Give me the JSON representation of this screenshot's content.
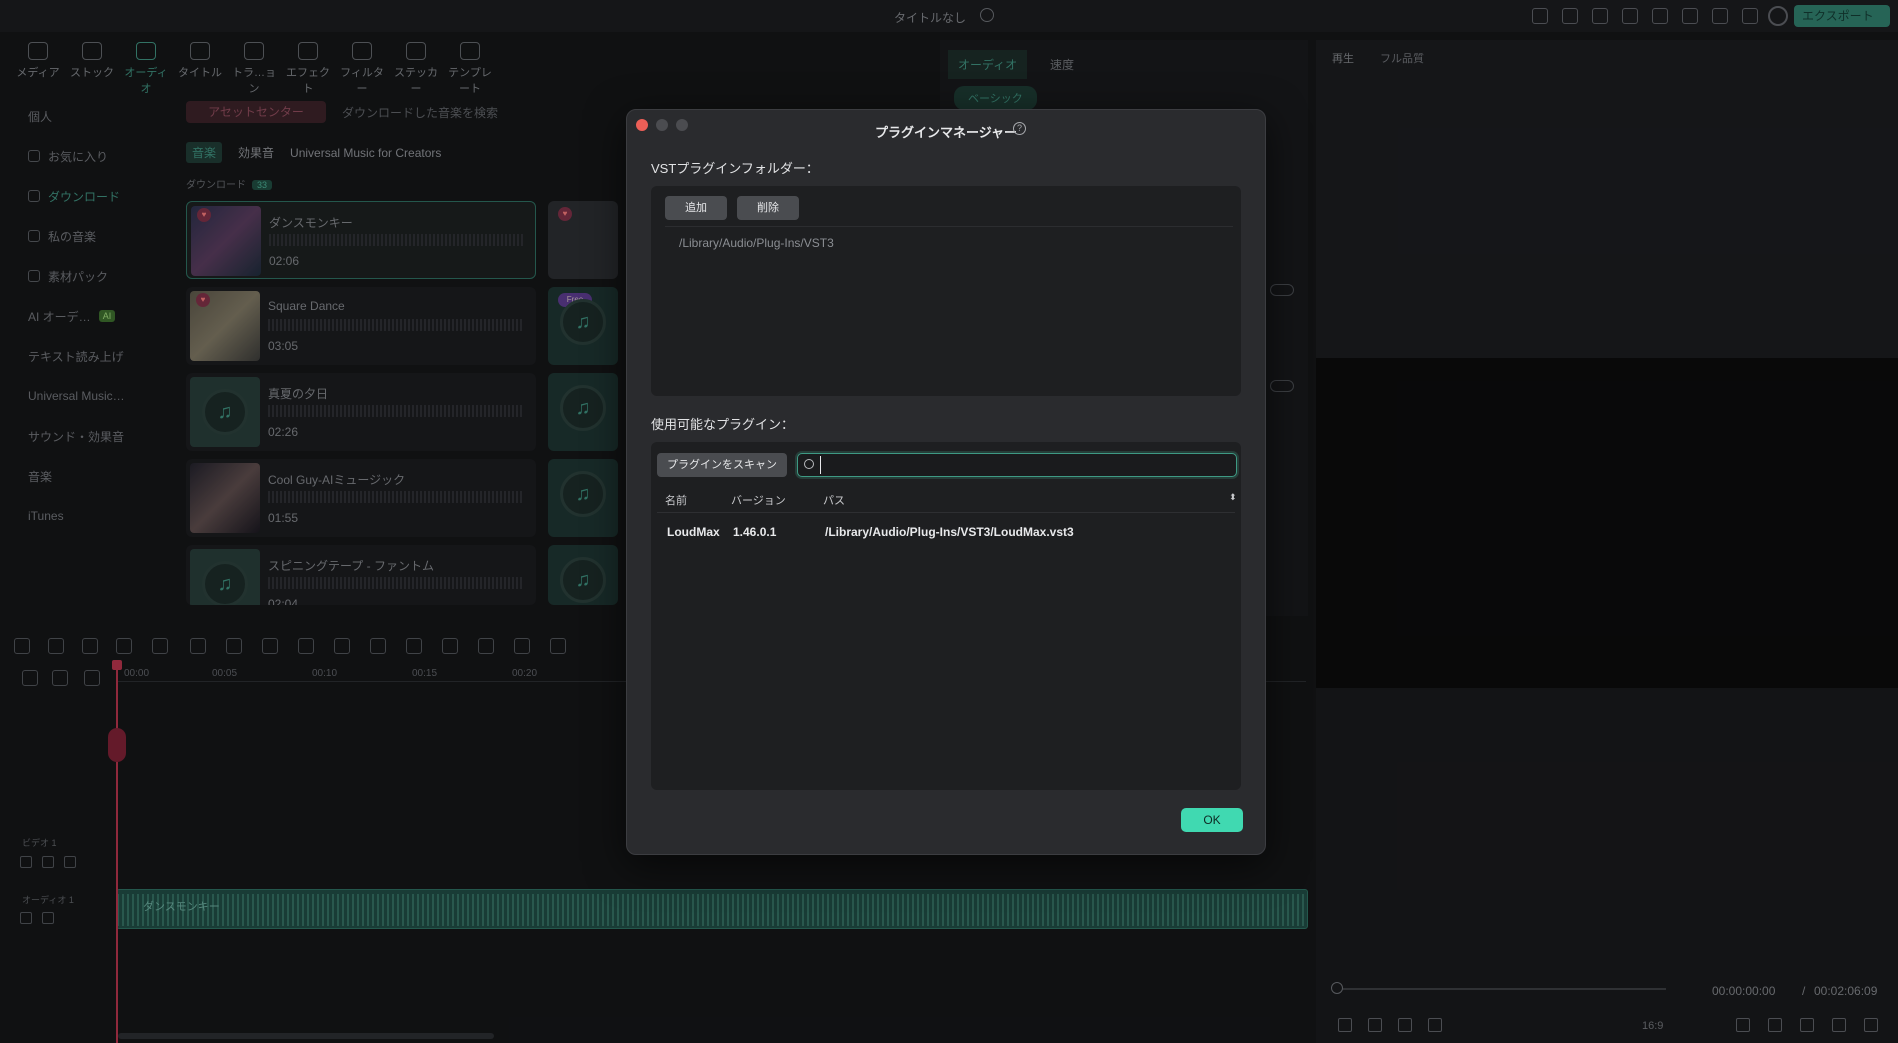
{
  "titlebar": {
    "title": "タイトルなし",
    "export_label": "エクスポート"
  },
  "asset_tabs": [
    {
      "label": "メディア"
    },
    {
      "label": "ストック"
    },
    {
      "label": "オーディオ"
    },
    {
      "label": "タイトル"
    },
    {
      "label": "トラ…ョン"
    },
    {
      "label": "エフェクト"
    },
    {
      "label": "フィルター"
    },
    {
      "label": "ステッカー"
    },
    {
      "label": "テンプレート"
    }
  ],
  "sidebar": {
    "items": [
      {
        "label": "個人"
      },
      {
        "label": "お気に入り"
      },
      {
        "label": "ダウンロード"
      },
      {
        "label": "私の音楽"
      },
      {
        "label": "素材パック"
      },
      {
        "label": "AI オーデ…"
      },
      {
        "label": "テキスト読み上げ"
      },
      {
        "label": "Universal Music…"
      },
      {
        "label": "サウンド・効果音"
      },
      {
        "label": "音楽"
      },
      {
        "label": "iTunes"
      }
    ],
    "ai_badge": "AI"
  },
  "browser": {
    "asset_center": "アセットセンター",
    "search_placeholder": "ダウンロードした音楽を検索",
    "tabs": [
      {
        "label": "音楽"
      },
      {
        "label": "効果音"
      },
      {
        "label": "Universal Music for Creators"
      }
    ],
    "download_label": "ダウンロード",
    "download_count": "33",
    "tracks": [
      {
        "name": "ダンスモンキー",
        "duration": "02:06"
      },
      {
        "name": "Square Dance",
        "duration": "03:05"
      },
      {
        "name": "真夏の夕日",
        "duration": "02:26"
      },
      {
        "name": "Cool Guy-AIミュージック",
        "duration": "01:55"
      },
      {
        "name": "スピニングテープ - ファントム",
        "duration": "02:04"
      }
    ],
    "free_badge": "Free"
  },
  "inspector": {
    "tab_audio": "オーディオ",
    "tab_speed": "速度",
    "basic_chip": "ベーシック"
  },
  "preview": {
    "play_label": "再生",
    "quality": "フル品質",
    "timecode_current": "00:00:00:00",
    "timecode_sep": "/",
    "timecode_total": "00:02:06:09",
    "ratio": "16:9"
  },
  "timeline": {
    "ruler": [
      "00:00",
      "00:05",
      "00:10",
      "00:15",
      "00:20"
    ],
    "video_track": "ビデオ 1",
    "audio_track": "オーディオ 1",
    "clip_name": "ダンスモンキー"
  },
  "dialog": {
    "title": "プラグインマネージャー",
    "help": "?",
    "vst_folder_label": "VSTプラグインフォルダー：",
    "add_button": "追加",
    "delete_button": "削除",
    "folder_path": "/Library/Audio/Plug-Ins/VST3",
    "available_label": "使用可能なプラグイン：",
    "scan_button": "プラグインをスキャン",
    "search_value": "",
    "columns": {
      "name": "名前",
      "version": "バージョン",
      "path": "パス"
    },
    "rows": [
      {
        "name": "LoudMax",
        "version": "1.46.0.1",
        "path": "/Library/Audio/Plug-Ins/VST3/LoudMax.vst3"
      }
    ],
    "ok_button": "OK"
  },
  "colors": {
    "accent": "#40d9b1",
    "close": "#ec5f57",
    "playhead": "#b0334a"
  }
}
